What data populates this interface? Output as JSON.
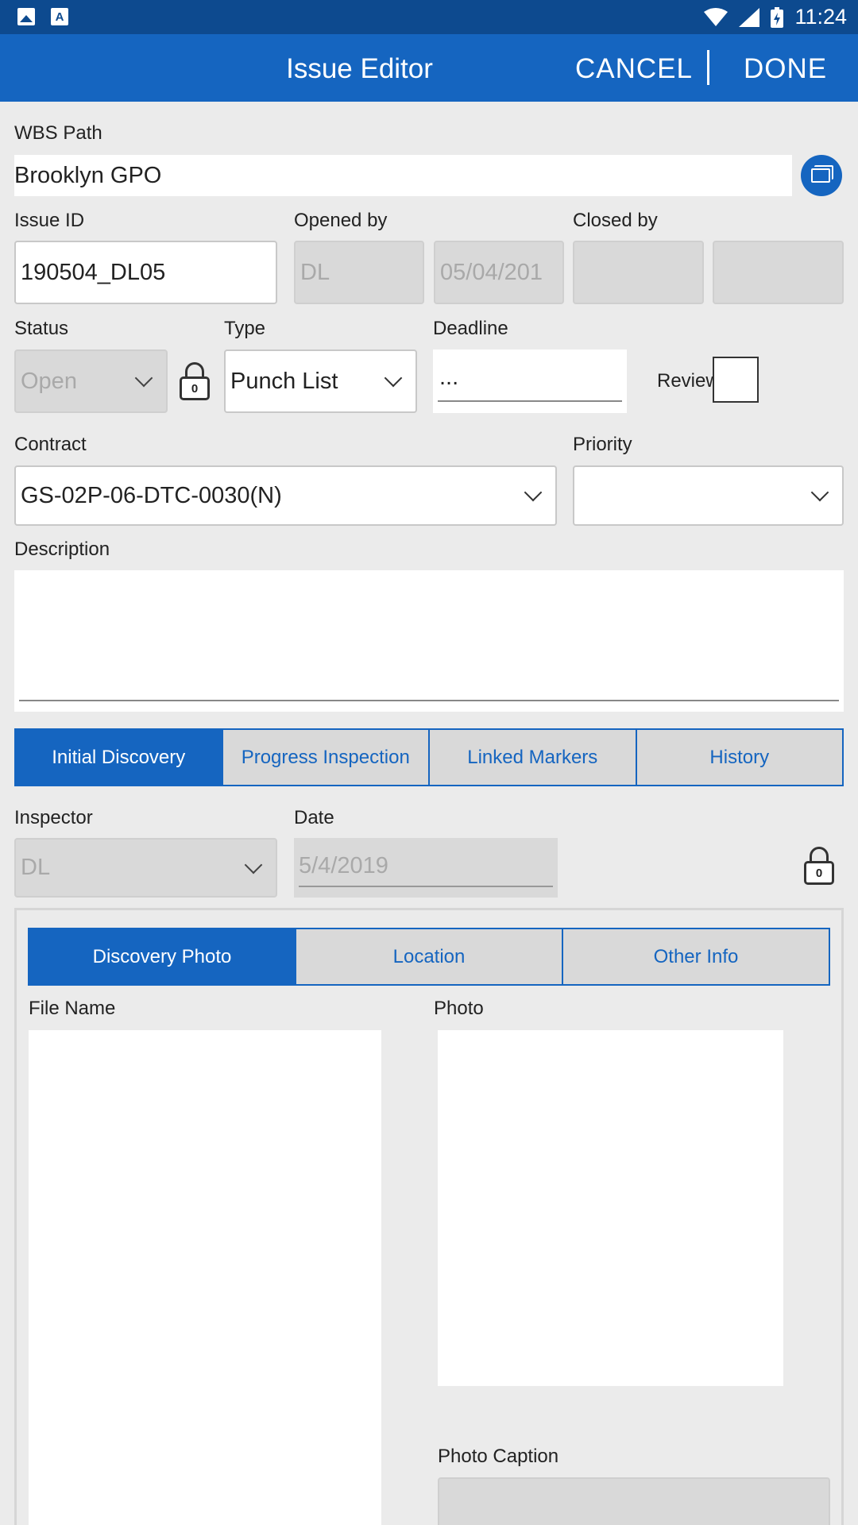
{
  "statusbar": {
    "time": "11:24",
    "icons": [
      "image-icon",
      "text-icon",
      "wifi-icon",
      "signal-icon",
      "battery-icon"
    ]
  },
  "appbar": {
    "title": "Issue Editor",
    "cancel_label": "CANCEL",
    "done_label": "DONE"
  },
  "wbs": {
    "label": "WBS Path",
    "value": "Brooklyn GPO"
  },
  "issue_id": {
    "label": "Issue ID",
    "value": "190504_DL05"
  },
  "opened_by": {
    "label": "Opened by",
    "user": "DL",
    "date": "05/04/201"
  },
  "closed_by": {
    "label": "Closed by",
    "user": "",
    "date": ""
  },
  "status": {
    "label": "Status",
    "value": "Open",
    "lock_count": "0"
  },
  "type": {
    "label": "Type",
    "value": "Punch List"
  },
  "deadline": {
    "label": "Deadline",
    "value": "..."
  },
  "review": {
    "label": "Review",
    "checked": false
  },
  "contract": {
    "label": "Contract",
    "value": "GS-02P-06-DTC-0030(N)"
  },
  "priority": {
    "label": "Priority",
    "value": ""
  },
  "description": {
    "label": "Description",
    "value": ""
  },
  "main_tabs": [
    {
      "label": "Initial Discovery",
      "active": true
    },
    {
      "label": "Progress Inspection",
      "active": false
    },
    {
      "label": "Linked Markers",
      "active": false
    },
    {
      "label": "History",
      "active": false
    }
  ],
  "inspector": {
    "label": "Inspector",
    "value": "DL"
  },
  "date": {
    "label": "Date",
    "value": "5/4/2019",
    "lock_count": "0"
  },
  "sub_tabs": [
    {
      "label": "Discovery Photo",
      "active": true
    },
    {
      "label": "Location",
      "active": false
    },
    {
      "label": "Other Info",
      "active": false
    }
  ],
  "file_name": {
    "label": "File Name"
  },
  "photo": {
    "label": "Photo"
  },
  "photo_caption": {
    "label": "Photo Caption",
    "value": ""
  },
  "colors": {
    "primary": "#1565c0",
    "statusbar": "#0d4a8f",
    "background": "#ebebeb",
    "disabled": "#d9d9d9"
  }
}
